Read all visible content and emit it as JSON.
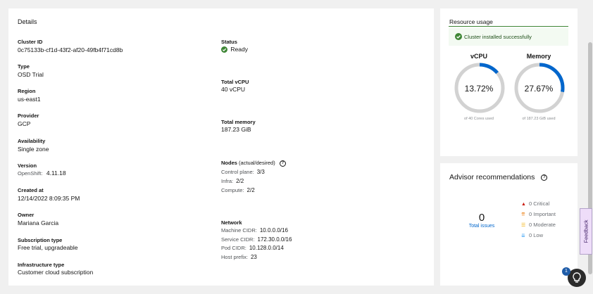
{
  "details": {
    "title": "Details",
    "left": [
      {
        "label": "Cluster ID",
        "value": "0c75133b-cf1d-43f2-af20-49fb4f71cd8b"
      },
      {
        "label": "Type",
        "value": "OSD Trial"
      },
      {
        "label": "Region",
        "value": "us-east1"
      },
      {
        "label": "Provider",
        "value": "GCP"
      },
      {
        "label": "Availability",
        "value": "Single zone"
      },
      {
        "label": "Version",
        "sub": "OpenShift:",
        "value": "4.11.18"
      },
      {
        "label": "Created at",
        "value": "12/14/2022 8:09:35 PM"
      },
      {
        "label": "Owner",
        "value": "Mariana Garcia"
      },
      {
        "label": "Subscription type",
        "value": "Free trial, upgradeable"
      },
      {
        "label": "Infrastructure type",
        "value": "Customer cloud subscription"
      }
    ],
    "status": {
      "label": "Status",
      "value": "Ready"
    },
    "total_vcpu": {
      "label": "Total vCPU",
      "value": "40 vCPU"
    },
    "total_memory": {
      "label": "Total memory",
      "value": "187.23 GiB"
    },
    "nodes": {
      "label": "Nodes",
      "label_suffix": "(actual/desired)",
      "rows": [
        {
          "key": "Control plane:",
          "value": "3/3"
        },
        {
          "key": "Infra:",
          "value": "2/2"
        },
        {
          "key": "Compute:",
          "value": "2/2"
        }
      ]
    },
    "network": {
      "label": "Network",
      "rows": [
        {
          "key": "Machine CIDR:",
          "value": "10.0.0.0/16"
        },
        {
          "key": "Service CIDR:",
          "value": "172.30.0.0/16"
        },
        {
          "key": "Pod CIDR:",
          "value": "10.128.0.0/14"
        },
        {
          "key": "Host prefix:",
          "value": "23"
        }
      ]
    }
  },
  "resource_usage": {
    "title": "Resource usage",
    "alert": "Cluster installed successfully",
    "vcpu": {
      "title": "vCPU",
      "value": "13.72%",
      "fraction": 0.1372,
      "caption": "of 40 Cores used"
    },
    "memory": {
      "title": "Memory",
      "value": "27.67%",
      "fraction": 0.2767,
      "caption": "of 187.23 GiB used"
    }
  },
  "advisor": {
    "title": "Advisor recommendations",
    "count": "0",
    "total_label": "Total issues",
    "severities": [
      {
        "label": "0 Critical",
        "color": "#c9190b",
        "icon": "critical-icon"
      },
      {
        "label": "0 Important",
        "color": "#ec7a08",
        "icon": "important-icon"
      },
      {
        "label": "0 Moderate",
        "color": "#f0ab00",
        "icon": "moderate-icon"
      },
      {
        "label": "0 Low",
        "color": "#2b9af3",
        "icon": "low-icon"
      }
    ]
  },
  "feedback": {
    "label": "Feedback"
  },
  "help": {
    "badge": "1"
  },
  "colors": {
    "accent": "#06c",
    "success": "#3e8635",
    "gauge": "#0066cc",
    "gauge_track": "#d2d2d2"
  }
}
